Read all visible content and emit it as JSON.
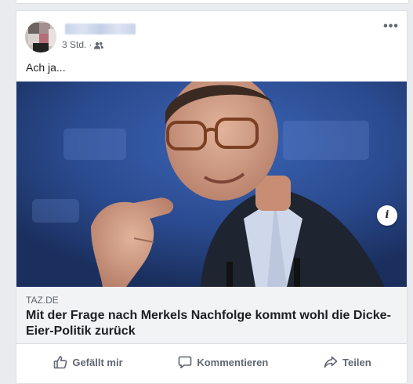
{
  "post": {
    "author_name": "",
    "time": "3 Std.",
    "separator": "·",
    "audience_icon": "friends-icon",
    "more_icon": "more-options-icon",
    "more_label": "•••",
    "text": "Ach ja..."
  },
  "link_preview": {
    "domain": "TAZ.DE",
    "title": "Mit der Frage nach Merkels Nachfolge kommt wohl die Dicke-Eier-Politik zurück",
    "info_label": "i"
  },
  "actions": {
    "like_label": "Gefällt mir",
    "comment_label": "Kommentieren",
    "share_label": "Teilen"
  },
  "colors": {
    "background": "#e9ebee",
    "card": "#ffffff",
    "link_bg": "#f2f3f5",
    "secondary_text": "#606770",
    "primary_text": "#1c1e21",
    "photo_backdrop": "#2a4a8e"
  }
}
